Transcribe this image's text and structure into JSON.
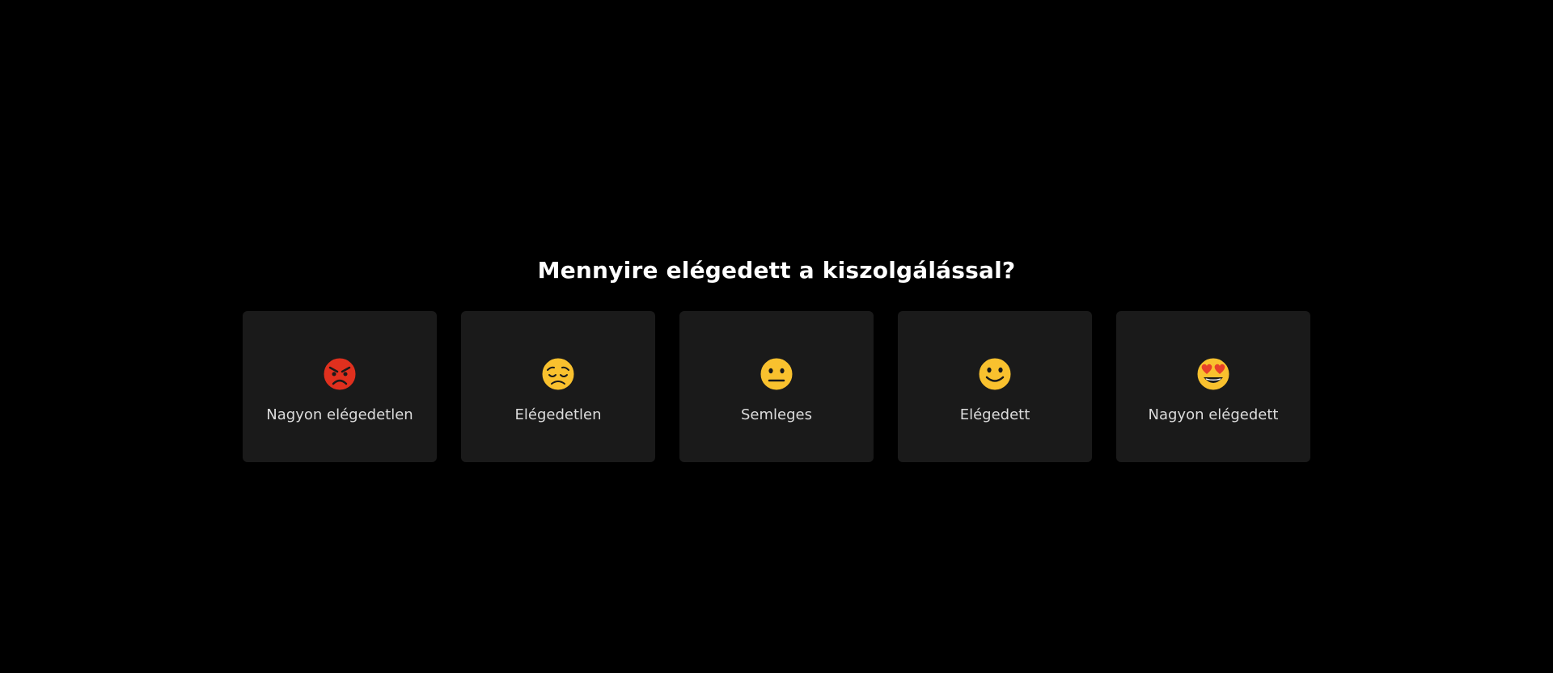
{
  "survey": {
    "question": "Mennyire elégedett a kiszolgálással?",
    "options": [
      {
        "label": "Nagyon elégedetlen",
        "icon": "angry-face-icon",
        "color": "#e0301e"
      },
      {
        "label": "Elégedetlen",
        "icon": "pensive-face-icon",
        "color": "#f9c12e"
      },
      {
        "label": "Semleges",
        "icon": "neutral-face-icon",
        "color": "#f9c12e"
      },
      {
        "label": "Elégedett",
        "icon": "slightly-smiling-face-icon",
        "color": "#f9c12e"
      },
      {
        "label": "Nagyon elégedett",
        "icon": "heart-eyes-face-icon",
        "color": "#f9c12e"
      }
    ]
  },
  "colors": {
    "background": "#000000",
    "card": "#1a1a1a",
    "text": "#ffffff",
    "label": "#dcdcdc"
  }
}
